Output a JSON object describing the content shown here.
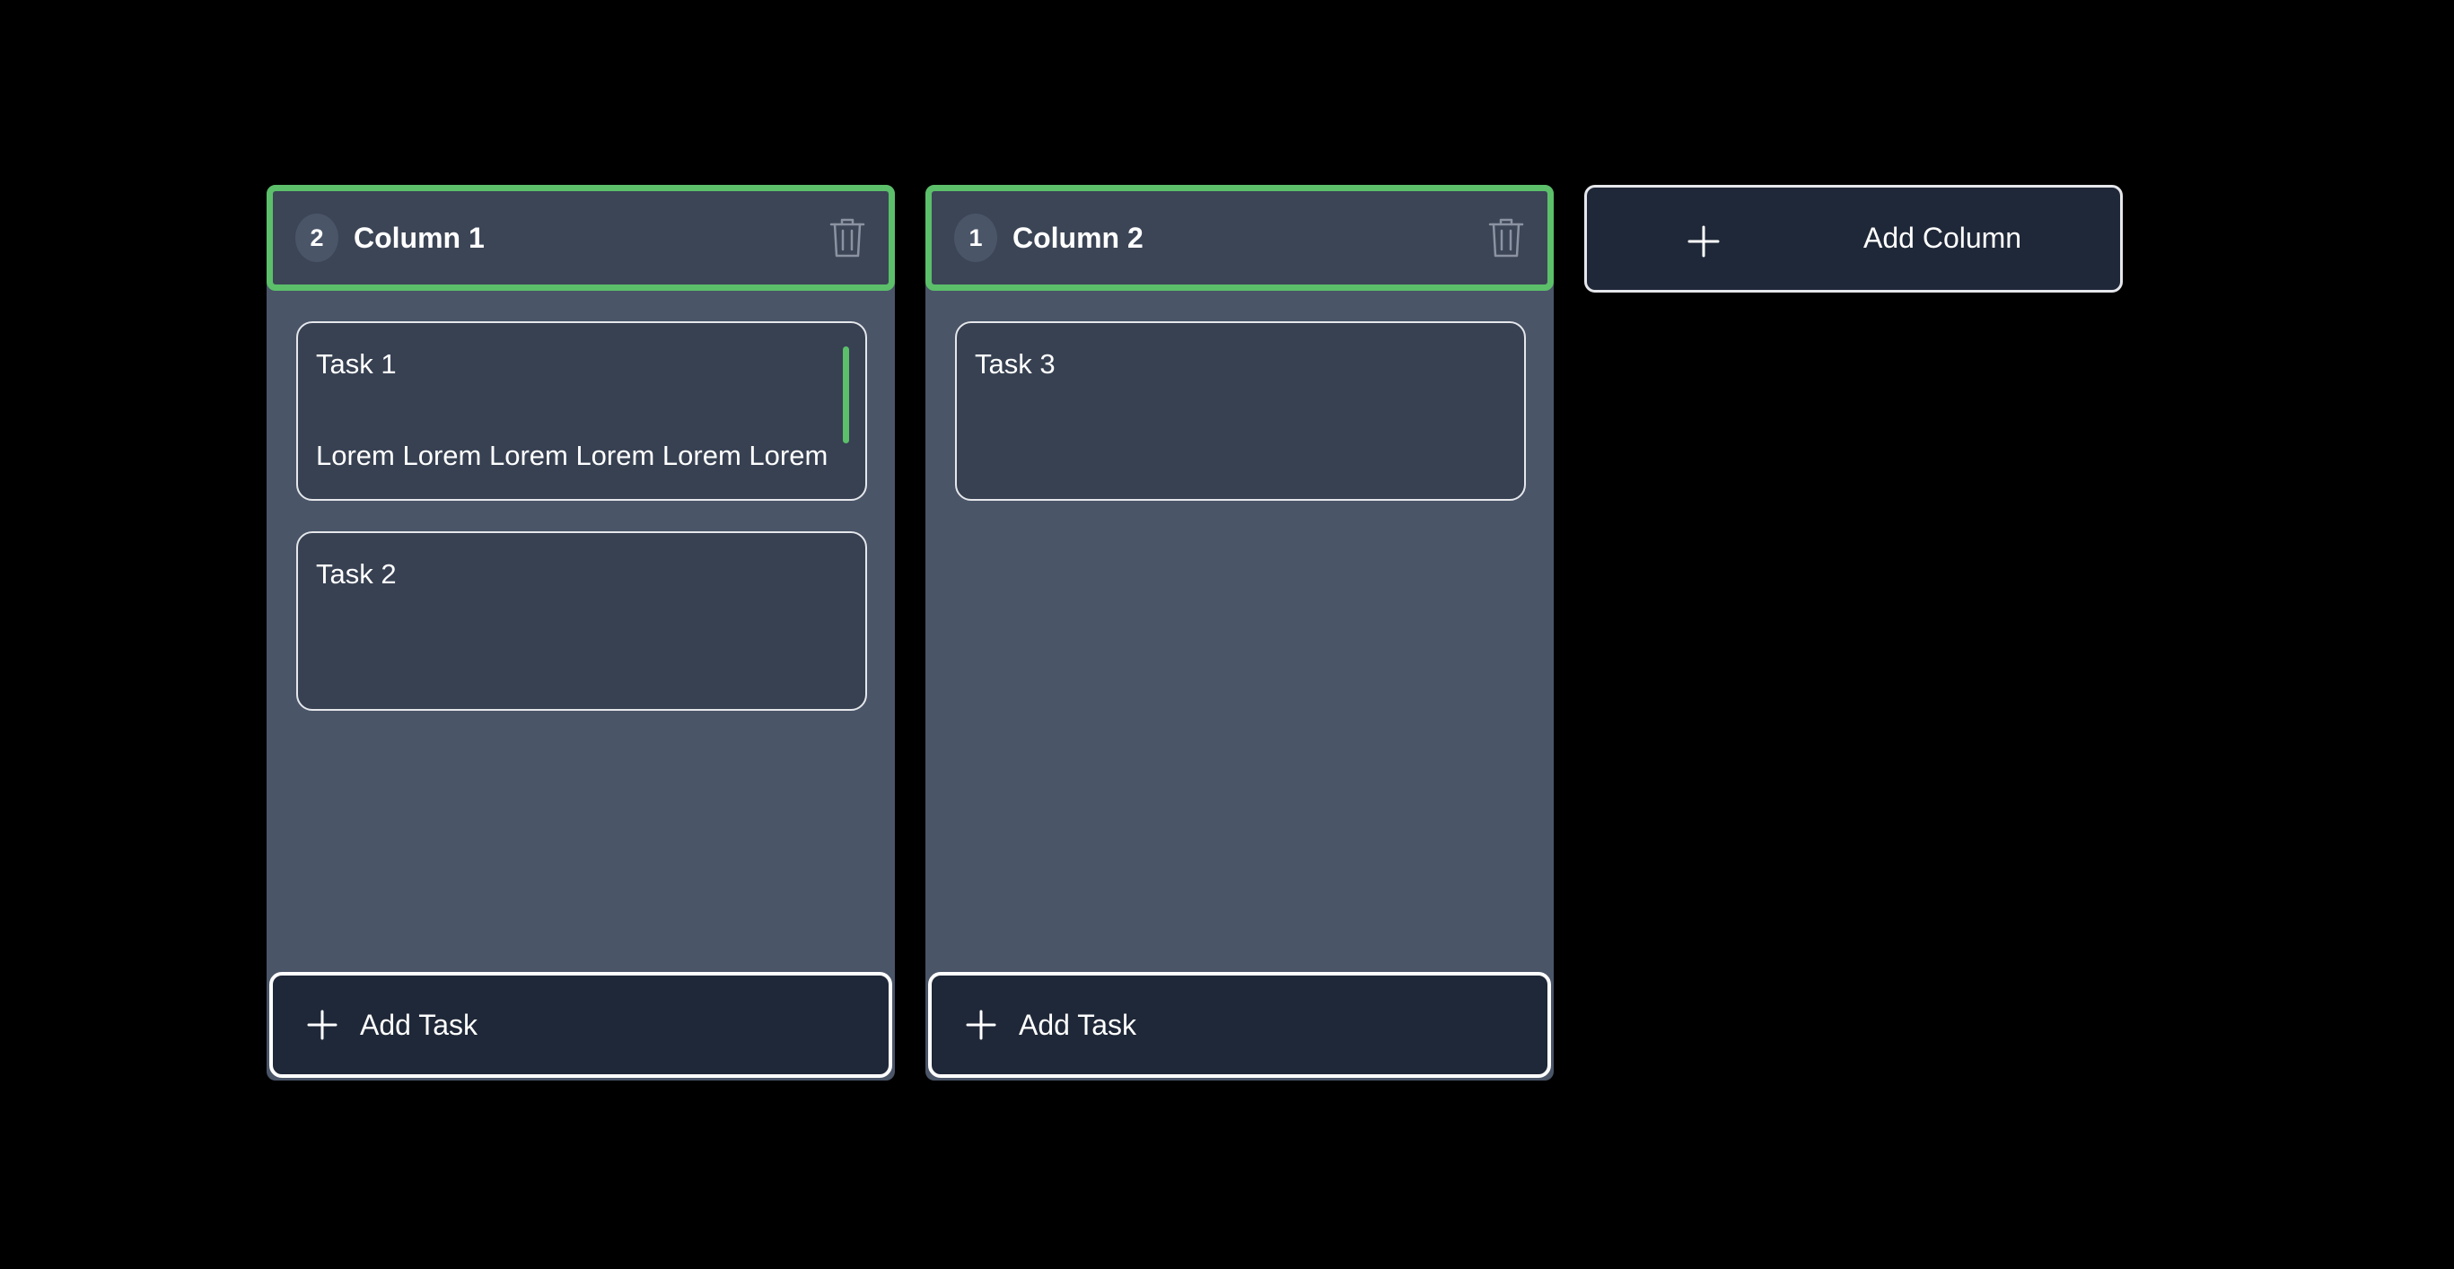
{
  "colors": {
    "background": "#000000",
    "column_bg": "#4a5568",
    "header_bg": "#3b4556",
    "accent_green": "#5cbf6a",
    "card_bg": "#374152",
    "button_bg": "#1f2838"
  },
  "columns": [
    {
      "count": "2",
      "title": "Column 1",
      "delete_icon": "trash-icon",
      "tasks": [
        {
          "title": "Task 1",
          "description": "Lorem Lorem Lorem Lorem Lorem Lorem"
        },
        {
          "title": "Task 2",
          "description": ""
        }
      ],
      "add_task_label": "Add Task"
    },
    {
      "count": "1",
      "title": "Column 2",
      "delete_icon": "trash-icon",
      "tasks": [
        {
          "title": "Task 3",
          "description": ""
        }
      ],
      "add_task_label": "Add Task"
    }
  ],
  "add_column": {
    "icon": "plus-icon",
    "label": "Add Column"
  }
}
